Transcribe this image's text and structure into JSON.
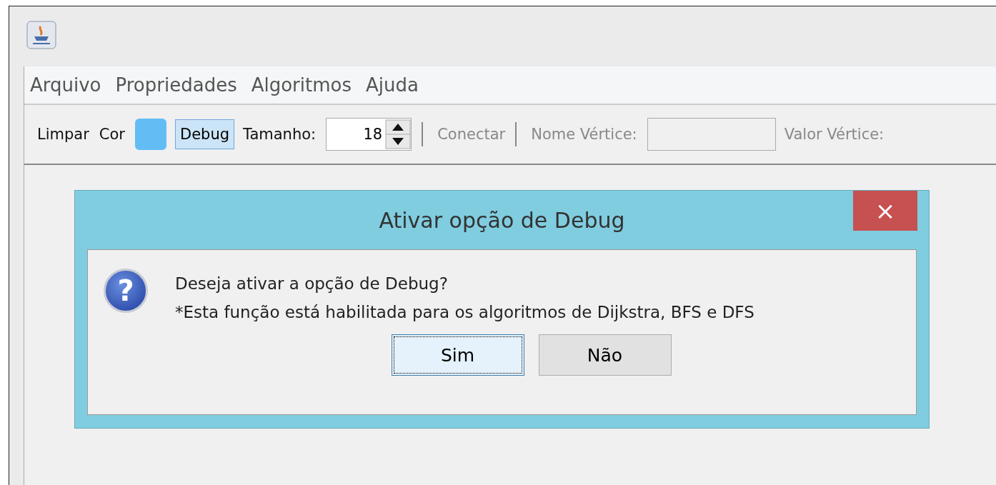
{
  "menu": [
    {
      "label": "Arquivo"
    },
    {
      "label": "Propriedades"
    },
    {
      "label": "Algoritmos"
    },
    {
      "label": "Ajuda"
    }
  ],
  "toolbar": [
    {
      "kind": "button",
      "label": "Limpar",
      "disabled": false
    },
    {
      "kind": "button",
      "label": "Cor",
      "disabled": false
    },
    {
      "kind": "color",
      "color": "#63bdf5"
    },
    {
      "kind": "toggle",
      "label": "Debug",
      "selected": true
    },
    {
      "kind": "label",
      "label": "Tamanho:",
      "disabled": false
    },
    {
      "kind": "spinner",
      "value": "18"
    },
    {
      "kind": "separator"
    },
    {
      "kind": "button",
      "label": "Conectar",
      "disabled": true
    },
    {
      "kind": "separator"
    },
    {
      "kind": "label",
      "label": "Nome Vértice:",
      "disabled": true
    },
    {
      "kind": "field",
      "disabled": true
    },
    {
      "kind": "label",
      "label": "Valor Vértice:",
      "disabled": true
    }
  ],
  "dialog": {
    "title": "Ativar opção de Debug",
    "close": "×",
    "icon": "?",
    "message": "Deseja ativar a opção de Debug?",
    "note": "*Esta função está habilitada para os algoritmos de Dijkstra, BFS e DFS",
    "buttons": [
      {
        "label": "Sim",
        "focused": true
      },
      {
        "label": "Não",
        "focused": false
      }
    ]
  }
}
